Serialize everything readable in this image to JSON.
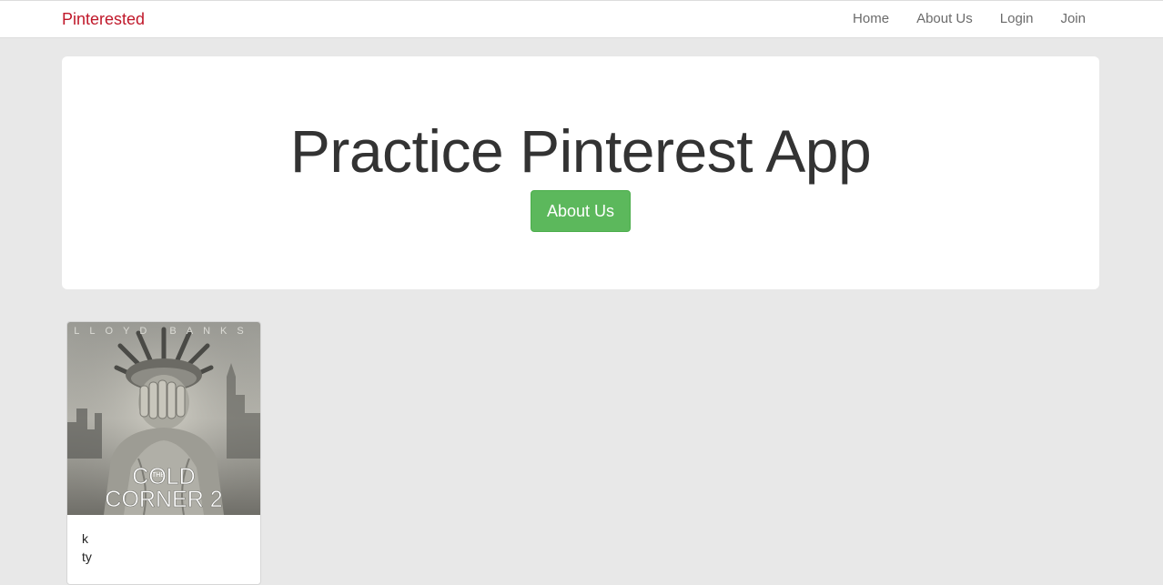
{
  "navbar": {
    "brand": "Pinterested",
    "links": [
      "Home",
      "About Us",
      "Login",
      "Join"
    ]
  },
  "jumbotron": {
    "title": "Practice Pinterest App",
    "button_label": "About Us"
  },
  "pins": [
    {
      "image": {
        "top_text": "LLOYD BANKS",
        "small_text": "THE",
        "title_line1": "COLD",
        "title_line2": "CORNER 2"
      },
      "caption_lines": [
        "k",
        "ty"
      ]
    }
  ],
  "colors": {
    "brand": "#c0182a",
    "page_background": "#e8e8e8",
    "button_success": "#5cb85c",
    "title_text": "#333333"
  }
}
